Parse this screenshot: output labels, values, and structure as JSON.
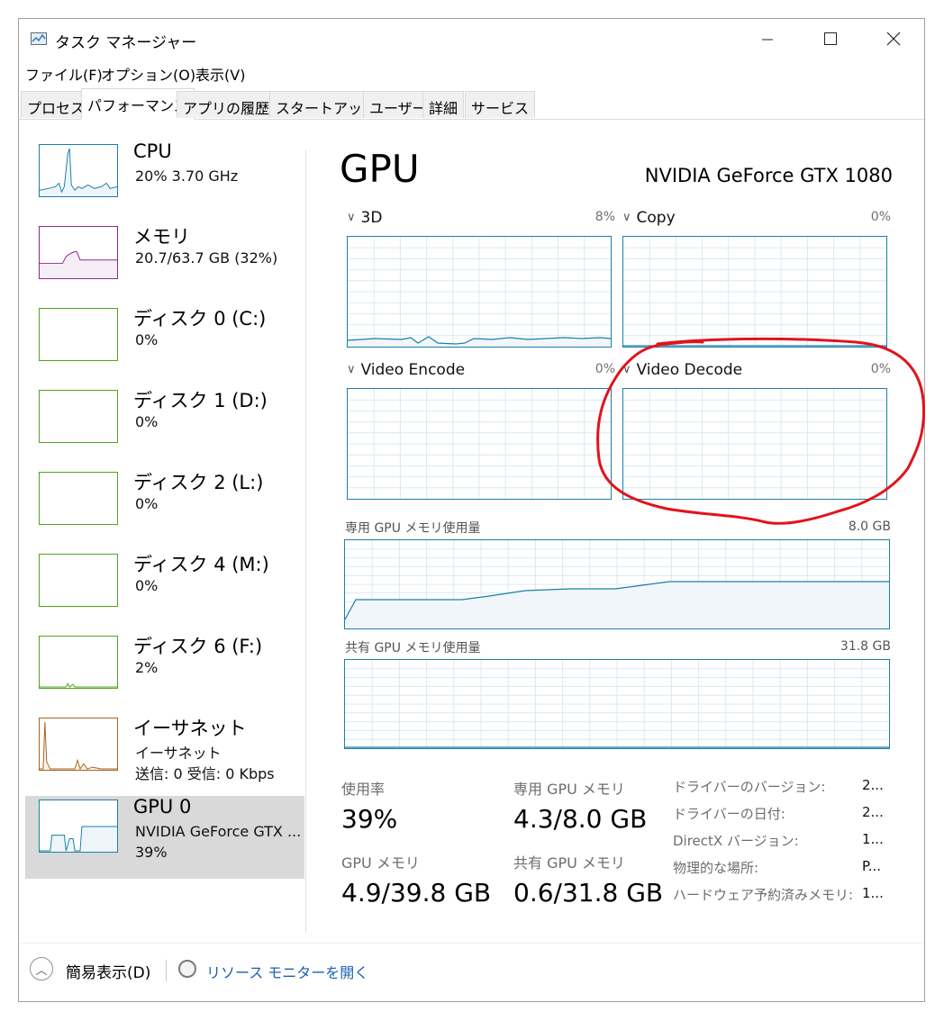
{
  "window": {
    "title": "タスク マネージャー",
    "minimize": "—",
    "maximize": "☐",
    "close": "✕"
  },
  "menu": [
    "ファイル(F)",
    "オプション(O)",
    "表示(V)"
  ],
  "tabs": [
    "プロセス",
    "パフォーマンス",
    "アプリの履歴",
    "スタートアップ",
    "ユーザー",
    "詳細",
    "サービス"
  ],
  "active_tab": "パフォーマンス",
  "sidebar": [
    {
      "name": "CPU",
      "sub1": "20%  3.70 GHz",
      "sub2": "",
      "color": "#1a7fa9"
    },
    {
      "name": "メモリ",
      "sub1": "20.7/63.7 GB (32%)",
      "sub2": "",
      "color": "#8b2a8b"
    },
    {
      "name": "ディスク 0 (C:)",
      "sub1": "0%",
      "sub2": "",
      "color": "#4da61e"
    },
    {
      "name": "ディスク 1 (D:)",
      "sub1": "0%",
      "sub2": "",
      "color": "#4da61e"
    },
    {
      "name": "ディスク 2 (L:)",
      "sub1": "0%",
      "sub2": "",
      "color": "#4da61e"
    },
    {
      "name": "ディスク 4 (M:)",
      "sub1": "0%",
      "sub2": "",
      "color": "#4da61e"
    },
    {
      "name": "ディスク 6 (F:)",
      "sub1": "2%",
      "sub2": "",
      "color": "#4da61e"
    },
    {
      "name": "イーサネット",
      "sub1": "イーサネット",
      "sub2": "送信: 0  受信: 0 Kbps",
      "color": "#a7641a"
    },
    {
      "name": "GPU 0",
      "sub1": "NVIDIA GeForce GTX ...",
      "sub2": "39%",
      "color": "#1a7fa9"
    }
  ],
  "gpu": {
    "title": "GPU",
    "model": "NVIDIA GeForce GTX 1080",
    "engines": [
      {
        "label": "3D",
        "pct": "8%"
      },
      {
        "label": "Copy",
        "pct": "0%"
      },
      {
        "label": "Video Encode",
        "pct": "0%"
      },
      {
        "label": "Video Decode",
        "pct": "0%"
      }
    ],
    "dedicated_label": "専用 GPU メモリ使用量",
    "dedicated_max": "8.0 GB",
    "shared_label": "共有 GPU メモリ使用量",
    "shared_max": "31.8 GB",
    "stats": {
      "usage_label": "使用率",
      "usage_value": "39%",
      "ded_label": "専用 GPU メモリ",
      "ded_value": "4.3/8.0 GB",
      "gpumem_label": "GPU メモリ",
      "gpumem_value": "4.9/39.8 GB",
      "shared_label": "共有 GPU メモリ",
      "shared_value": "0.6/31.8 GB"
    },
    "info": [
      {
        "label": "ドライバーのバージョン:",
        "value": "2..."
      },
      {
        "label": "ドライバーの日付:",
        "value": "2..."
      },
      {
        "label": "DirectX バージョン:",
        "value": "1..."
      },
      {
        "label": "物理的な場所:",
        "value": "P..."
      },
      {
        "label": "ハードウェア予約済みメモリ:",
        "value": "1..."
      }
    ]
  },
  "footer": {
    "fewer_details": "簡易表示(D)",
    "resource_monitor": "リソース モニターを開く"
  },
  "colors": {
    "gpu_line": "#1a7fa9",
    "gpu_fill": "#f1f6fa",
    "grid": "#d9e9f1",
    "annotation": "#e0141b"
  }
}
